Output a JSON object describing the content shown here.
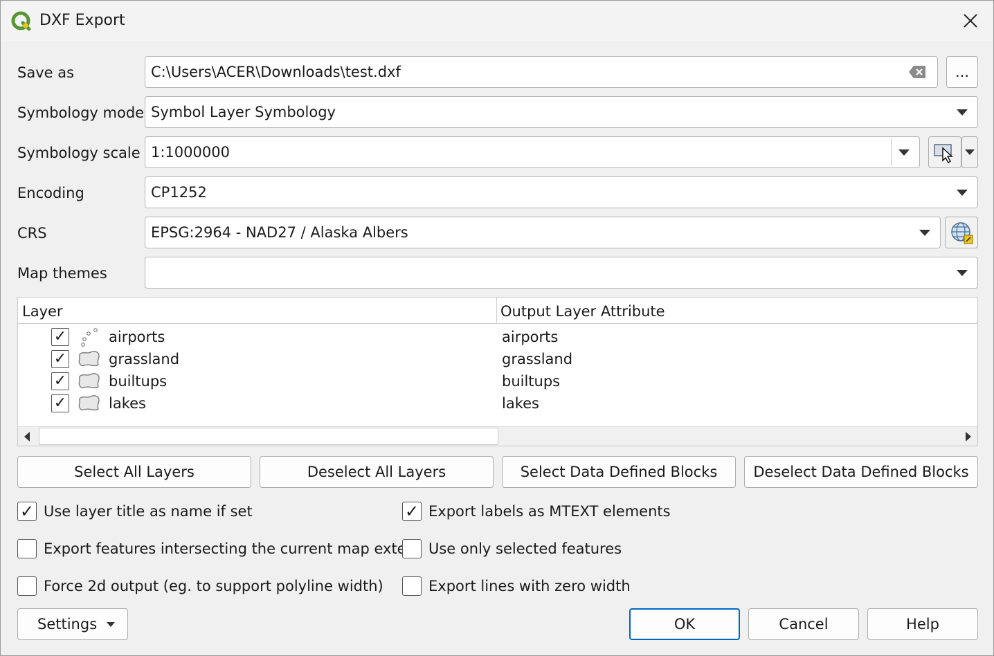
{
  "window": {
    "title": "DXF Export"
  },
  "form": {
    "save_as_label": "Save as",
    "save_as_value": "C:\\Users\\ACER\\Downloads\\test.dxf",
    "browse_label": "...",
    "symbology_mode_label": "Symbology mode",
    "symbology_mode_value": "Symbol Layer Symbology",
    "symbology_scale_label": "Symbology scale",
    "symbology_scale_value": "1:1000000",
    "encoding_label": "Encoding",
    "encoding_value": "CP1252",
    "crs_label": "CRS",
    "crs_value": "EPSG:2964 - NAD27 / Alaska Albers",
    "map_themes_label": "Map themes",
    "map_themes_value": ""
  },
  "layers_table": {
    "headers": [
      "Layer",
      "Output Layer Attribute"
    ],
    "rows": [
      {
        "checked": true,
        "icon": "point-layer-icon",
        "name": "airports",
        "attribute": "airports"
      },
      {
        "checked": true,
        "icon": "polygon-layer-icon",
        "name": "grassland",
        "attribute": "grassland"
      },
      {
        "checked": true,
        "icon": "polygon-layer-icon",
        "name": "builtups",
        "attribute": "builtups"
      },
      {
        "checked": true,
        "icon": "polygon-layer-icon",
        "name": "lakes",
        "attribute": "lakes"
      }
    ]
  },
  "layer_buttons": {
    "select_all": "Select All Layers",
    "deselect_all": "Deselect All Layers",
    "select_blocks": "Select Data Defined Blocks",
    "deselect_blocks": "Deselect Data Defined Blocks"
  },
  "options": {
    "use_layer_title": {
      "label": "Use layer title as name if set",
      "checked": true
    },
    "export_labels_mtext": {
      "label": "Export labels as MTEXT elements",
      "checked": true
    },
    "intersect_extent": {
      "label": "Export features intersecting the current map extent",
      "checked": false
    },
    "only_selected": {
      "label": "Use only selected features",
      "checked": false
    },
    "force_2d": {
      "label": "Force 2d output (eg. to support polyline width)",
      "checked": false
    },
    "zero_width_lines": {
      "label": "Export lines with zero width",
      "checked": false
    }
  },
  "footer": {
    "settings_label": "Settings",
    "ok_label": "OK",
    "cancel_label": "Cancel",
    "help_label": "Help"
  },
  "colors": {
    "accent": "#0067c0",
    "brand_green": "#589632",
    "brand_yellow": "#f0c419"
  }
}
